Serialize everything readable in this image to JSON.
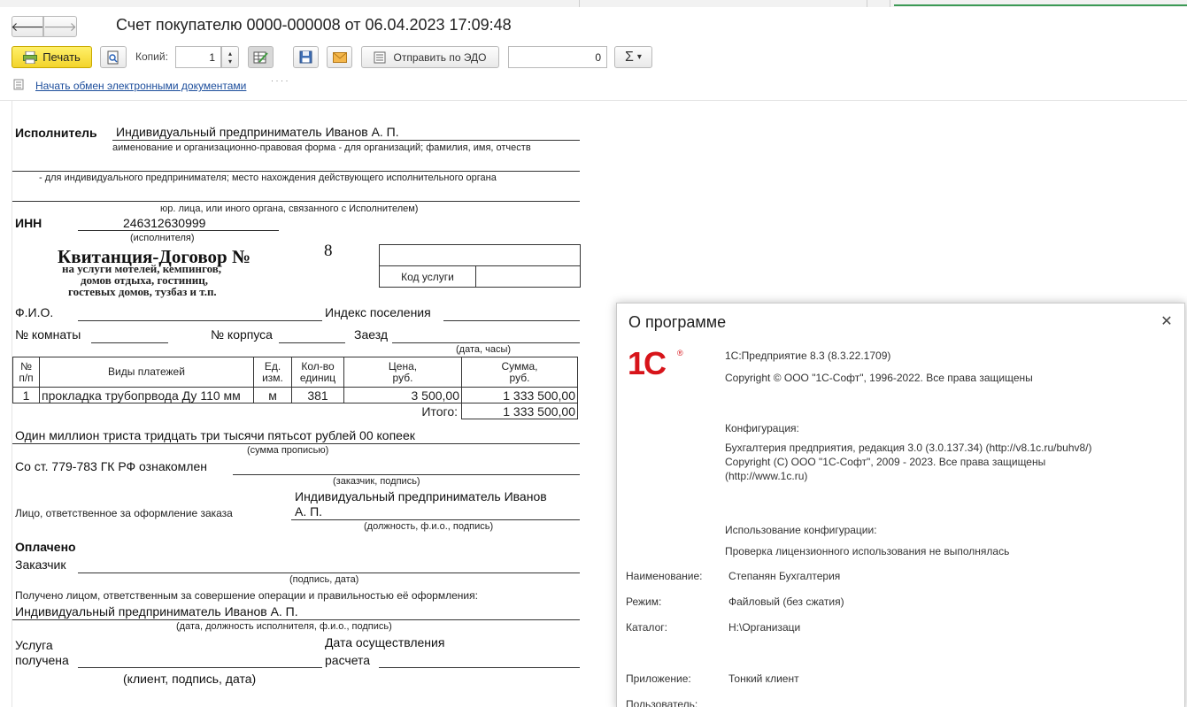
{
  "window": {
    "title": "Счет покупателю 0000-000008 от 06.04.2023 17:09:48"
  },
  "toolbar": {
    "back_glyph": "🡐",
    "forward_glyph": "🡒",
    "print_label": "Печать",
    "copies_label": "Копий:",
    "copies_value": "1",
    "send_edo_label": "Отправить по ЭДО",
    "sum_value": "0",
    "sum_glyph": "Σ",
    "dropdown_glyph": "▾"
  },
  "edo_link": {
    "label": "Начать обмен электронными документами",
    "trailing": "· · · ·"
  },
  "document": {
    "executor_label": "Исполнитель",
    "executor_value": "Индивидуальный предприниматель Иванов А. П.",
    "executor_hint1": "аименование и организационно-правовая форма - для организаций; фамилия, имя, отчеств",
    "executor_hint2": "- для индивидуального предпринимателя;  место нахождения действующего исполнительного органа",
    "executor_hint3": "юр. лица, или иного органа, связанного с Исполнителем)",
    "inn_label": "ИНН",
    "inn_value": "246312630999",
    "inn_hint": "(исполнителя)",
    "receipt_title": "Квитанция-Договор №",
    "receipt_number": "8",
    "receipt_sub1": "на услуги мотелей, кемпингов,",
    "receipt_sub2": "домов отдыха, гостиниц,",
    "receipt_sub3": "гостевых домов, тузбаз и т.п.",
    "service_code_label": "Код услуги",
    "fio_label": "Ф.И.О.",
    "index_label": "Индекс поселения",
    "room_label": "№ комнаты",
    "building_label": "№ корпуса",
    "arrival_label": "Заезд",
    "datetime_hint": "(дата, часы)",
    "table": {
      "headers": {
        "num": [
          "№",
          "п/п"
        ],
        "kind": "Виды платежей",
        "unit": [
          "Ед.",
          "изм."
        ],
        "qty": [
          "Кол-во",
          "единиц"
        ],
        "price": [
          "Цена,",
          "руб."
        ],
        "sum": [
          "Сумма,",
          "руб."
        ]
      },
      "rows": [
        {
          "num": "1",
          "kind": "прокладка трубопрвода Ду 110 мм",
          "unit": "м",
          "qty": "381",
          "price": "3 500,00",
          "sum": "1 333 500,00"
        }
      ],
      "total_label": "Итого:",
      "total_value": "1 333 500,00"
    },
    "amount_words": "Один миллион триста тридцать три тысячи пятьсот рублей 00 копеек",
    "amount_hint": "(сумма прописью)",
    "gk_text": "Со ст. 779-783 ГК РФ ознакомлен",
    "gk_hint": "(заказчик, подпись)",
    "responsible_label": "Лицо, ответственное за оформление заказа",
    "responsible_value1": "Индивидуальный предприниматель Иванов",
    "responsible_value2": "А. П.",
    "responsible_hint": "(должность, ф.и.о., подпись)",
    "paid_label": "Оплачено",
    "customer_label": "Заказчик",
    "customer_hint": "(подпись, дата)",
    "received_text": "Получено лицом, ответственным за совершение операции и правильностью её оформления:",
    "received_value": "Индивидуальный предприниматель Иванов А. П.",
    "received_hint": "(дата, должность исполнителя, ф.и.о., подпись)",
    "service_received1": "Услуга",
    "service_received2": "получена",
    "settlement_date1": "Дата осуществления",
    "settlement_date2": "расчета",
    "client_hint": "(клиент, подпись, дата)"
  },
  "about_dialog": {
    "title": "О программе",
    "close_glyph": "✕",
    "logo_text": "1С",
    "logo_reg": "®",
    "platform": "1С:Предприятие 8.3 (8.3.22.1709)",
    "copyright": "Copyright © ООО \"1С-Софт\", 1996-2022. Все права защищены",
    "config_label": "Конфигурация:",
    "config_line1": "Бухгалтерия предприятия, редакция 3.0 (3.0.137.34) (http://v8.1c.ru/buhv8/)",
    "config_line2": "Copyright (С) ООО \"1С-Софт\", 2009 - 2023. Все права защищены",
    "config_line3": "(http://www.1c.ru)",
    "usage_label": "Использование конфигурации:",
    "usage_value": "Проверка лицензионного использования не выполнялась",
    "name_label": "Наименование:",
    "name_value": "Степанян Бухгалтерия",
    "mode_label": "Режим:",
    "mode_value": "Файловый (без сжатия)",
    "catalog_label": "Каталог:",
    "catalog_value": "H:\\Организаци",
    "app_label": "Приложение:",
    "app_value": "Тонкий клиент",
    "user_label": "Пользователь:"
  }
}
